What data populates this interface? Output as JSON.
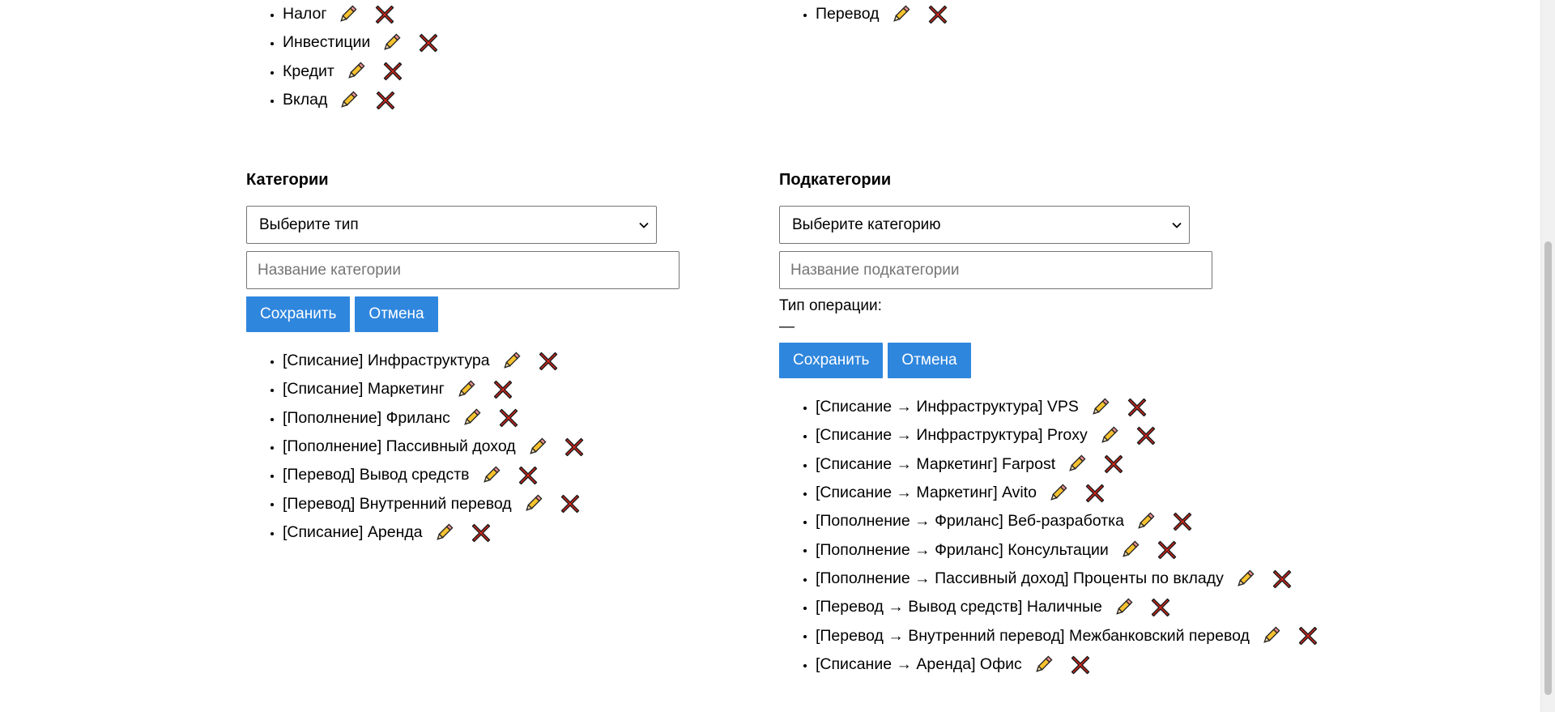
{
  "types_list": [
    "Налог",
    "Инвестиции",
    "Кредит",
    "Вклад"
  ],
  "transfer_list": [
    "Перевод"
  ],
  "categories": {
    "title": "Категории",
    "select_value": "Выберите тип",
    "name_placeholder": "Название категории",
    "save_label": "Сохранить",
    "cancel_label": "Отмена",
    "items": [
      "[Списание] Инфраструктура",
      "[Списание] Маркетинг",
      "[Пополнение] Фриланс",
      "[Пополнение] Пассивный доход",
      "[Перевод] Вывод средств",
      "[Перевод] Внутренний перевод",
      "[Списание] Аренда"
    ]
  },
  "subcategories": {
    "title": "Подкатегории",
    "select_value": "Выберите категорию",
    "name_placeholder": "Название подкатегории",
    "operation_type_label": "Тип операции:",
    "operation_type_value": "—",
    "save_label": "Сохранить",
    "cancel_label": "Отмена",
    "items": [
      "[Списание → Инфраструктура] VPS",
      "[Списание → Инфраструктура] Proxy",
      "[Списание → Маркетинг] Farpost",
      "[Списание → Маркетинг] Avito",
      "[Пополнение → Фриланс] Веб-разработка",
      "[Пополнение → Фриланс] Консультации",
      "[Пополнение → Пассивный доход] Проценты по вкладу",
      "[Перевод → Вывод средств] Наличные",
      "[Перевод → Внутренний перевод] Межбанковский перевод",
      "[Списание → Аренда] Офис"
    ]
  },
  "icons": {
    "edit": "pencil-icon",
    "delete": "cross-icon"
  },
  "colors": {
    "button": "#2f86dd",
    "delete": "#d6261c",
    "pencil": "#f6c22f"
  }
}
